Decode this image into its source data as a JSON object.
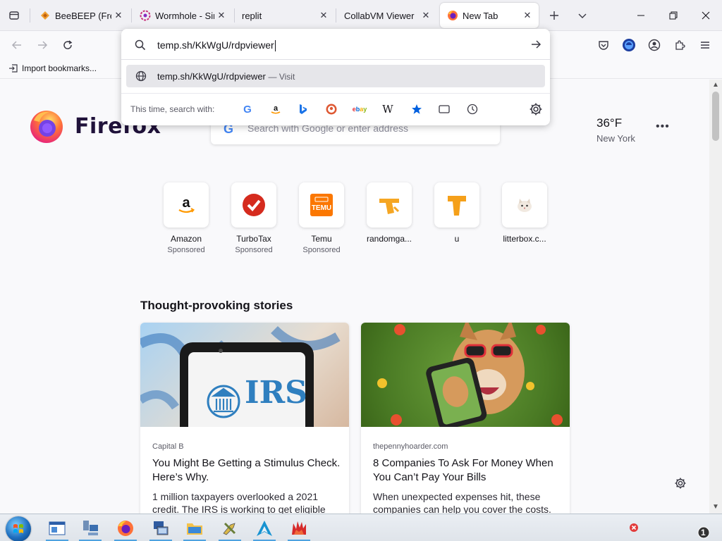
{
  "tabs": [
    {
      "title": "BeeBEEP (Free O",
      "active": false
    },
    {
      "title": "Wormhole - Sim",
      "active": false
    },
    {
      "title": "replit",
      "active": false
    },
    {
      "title": "CollabVM Viewer",
      "active": false
    },
    {
      "title": "New Tab",
      "active": true
    }
  ],
  "url_bar": {
    "value": "temp.sh/KkWgU/rdpviewer",
    "suggestion": "temp.sh/KkWgU/rdpviewer",
    "suggestion_action": "— Visit",
    "search_with_label": "This time, search with:",
    "engines": [
      "google-icon",
      "amazon-icon",
      "bing-icon",
      "duckduckgo-icon",
      "ebay-icon",
      "wikipedia-icon",
      "bookmarks-icon",
      "tabs-icon",
      "history-icon"
    ]
  },
  "bookmarks_toolbar": {
    "import_label": "Import bookmarks..."
  },
  "newtab": {
    "brand": "Firefox",
    "search_placeholder": "Search with Google or enter address",
    "weather": {
      "temp": "36°F",
      "city": "New York"
    },
    "shortcuts": [
      {
        "name": "Amazon",
        "sponsored": "Sponsored"
      },
      {
        "name": "TurboTax",
        "sponsored": "Sponsored"
      },
      {
        "name": "Temu",
        "sponsored": "Sponsored"
      },
      {
        "name": "randomga...",
        "sponsored": ""
      },
      {
        "name": "u",
        "sponsored": ""
      },
      {
        "name": "litterbox.c...",
        "sponsored": ""
      }
    ],
    "stories_title": "Thought-provoking stories",
    "stories": [
      {
        "source": "Capital B",
        "headline": "You Might Be Getting a Stimulus Check. Here’s Why.",
        "excerpt": "1 million taxpayers overlooked a 2021 credit. The IRS is working to get eligible",
        "image_text": "IRS"
      },
      {
        "source": "thepennyhoarder.com",
        "headline": "8 Companies To Ask For Money When You Can’t Pay Your Bills",
        "excerpt": "When unexpected expenses hit, these companies can help you cover the costs."
      }
    ]
  },
  "colors": {
    "accent": "#0061e0",
    "tab_strip": "#f0f0f4",
    "page_bg": "#f9f9fb"
  },
  "taskbar": {
    "tray_badge": "1"
  }
}
